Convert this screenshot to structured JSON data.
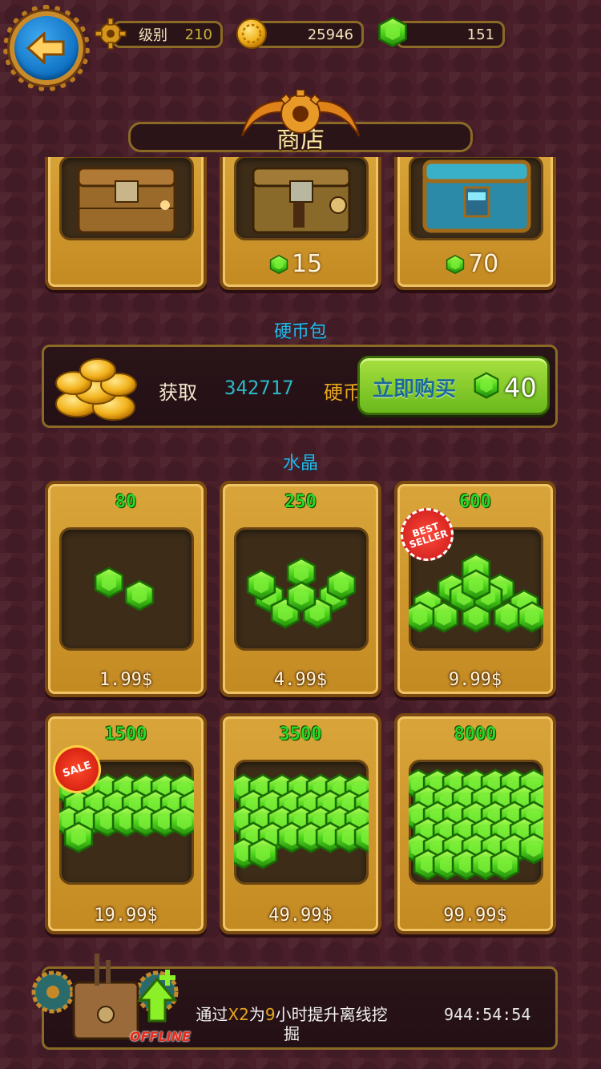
{
  "topbar": {
    "level_label": "级别",
    "level_value": "210",
    "coins": "25946",
    "gems": "151"
  },
  "header": {
    "title": "商店"
  },
  "chests": [
    {
      "price": ""
    },
    {
      "price": "15"
    },
    {
      "price": "70"
    }
  ],
  "coin_pack": {
    "section_title": "硬币包",
    "get_label": "获取",
    "amount": "342717",
    "unit": "硬币",
    "buy_label": "立即购买",
    "cost": "40"
  },
  "crystals": {
    "section_title": "水晶",
    "items": [
      {
        "amount": "80",
        "price": "1.99$"
      },
      {
        "amount": "250",
        "price": "4.99$"
      },
      {
        "amount": "600",
        "price": "9.99$",
        "badge": "BEST SELLER"
      },
      {
        "amount": "1500",
        "price": "19.99$",
        "badge": "SALE"
      },
      {
        "amount": "3500",
        "price": "49.99$"
      },
      {
        "amount": "8000",
        "price": "99.99$"
      }
    ]
  },
  "offline": {
    "text_prefix": "通过",
    "x_label": "X2",
    "text_mid": "为",
    "hours": "9",
    "text_suffix": "小时提升离线挖掘",
    "timer": "944:54:54",
    "badge": "OFFLINE"
  },
  "colors": {
    "gem_green": "#35d21a",
    "section_blue": "#27b8e8",
    "gold": "#d9a53a"
  }
}
